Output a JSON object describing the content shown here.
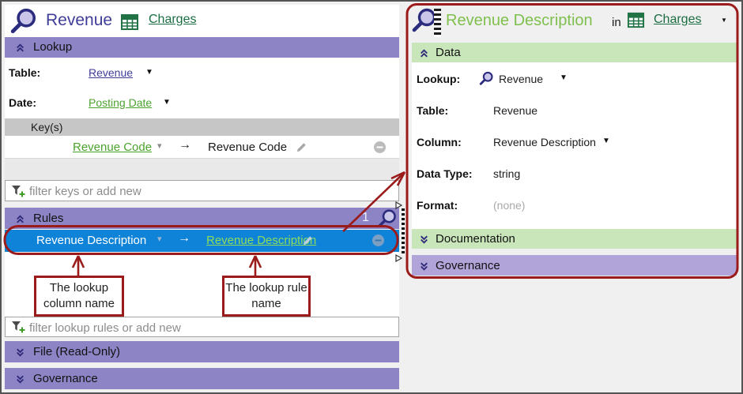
{
  "glyphs": {
    "arrow_right": "→",
    "dropdown": "▼",
    "dropdown_small": "▾"
  },
  "colors": {
    "header_purple": "#8d84c6",
    "header_purple_light": "#b1a4d8",
    "header_green": "#c9e5ba",
    "selection_blue": "#0f83d8",
    "annotation_red": "#9b1b1b",
    "link_green": "#4ba32e",
    "link_dark_green": "#1b6e42",
    "title_purple": "#403d99",
    "title_green": "#7fbf4d"
  },
  "left": {
    "title": "Revenue",
    "context_link": "Charges",
    "lookup": {
      "header": "Lookup",
      "table_label": "Table:",
      "table_value": "Revenue",
      "date_label": "Date:",
      "date_value": "Posting Date",
      "keys_header": "Key(s)",
      "key_source": "Revenue Code",
      "key_target": "Revenue Code",
      "filter_placeholder": "filter keys or add new"
    },
    "rules": {
      "header": "Rules",
      "count": "1",
      "rule_source": "Revenue Description",
      "rule_target": "Revenue Description",
      "filter_placeholder": "filter lookup rules or add new"
    },
    "file_header": "File (Read-Only)",
    "governance_header": "Governance"
  },
  "right": {
    "title": "Revenue Description",
    "in_word": "in",
    "context_link": "Charges",
    "data": {
      "header": "Data",
      "rows": [
        {
          "label": "Lookup:",
          "value": "Revenue"
        },
        {
          "label": "Table:",
          "value": "Revenue"
        },
        {
          "label": "Column:",
          "value": "Revenue Description"
        },
        {
          "label": "Data Type:",
          "value": "string"
        },
        {
          "label": "Format:",
          "value": "(none)"
        }
      ]
    },
    "documentation_header": "Documentation",
    "governance_header": "Governance"
  },
  "annotations": {
    "callout_column": "The lookup column name",
    "callout_rule": "The lookup rule name"
  }
}
